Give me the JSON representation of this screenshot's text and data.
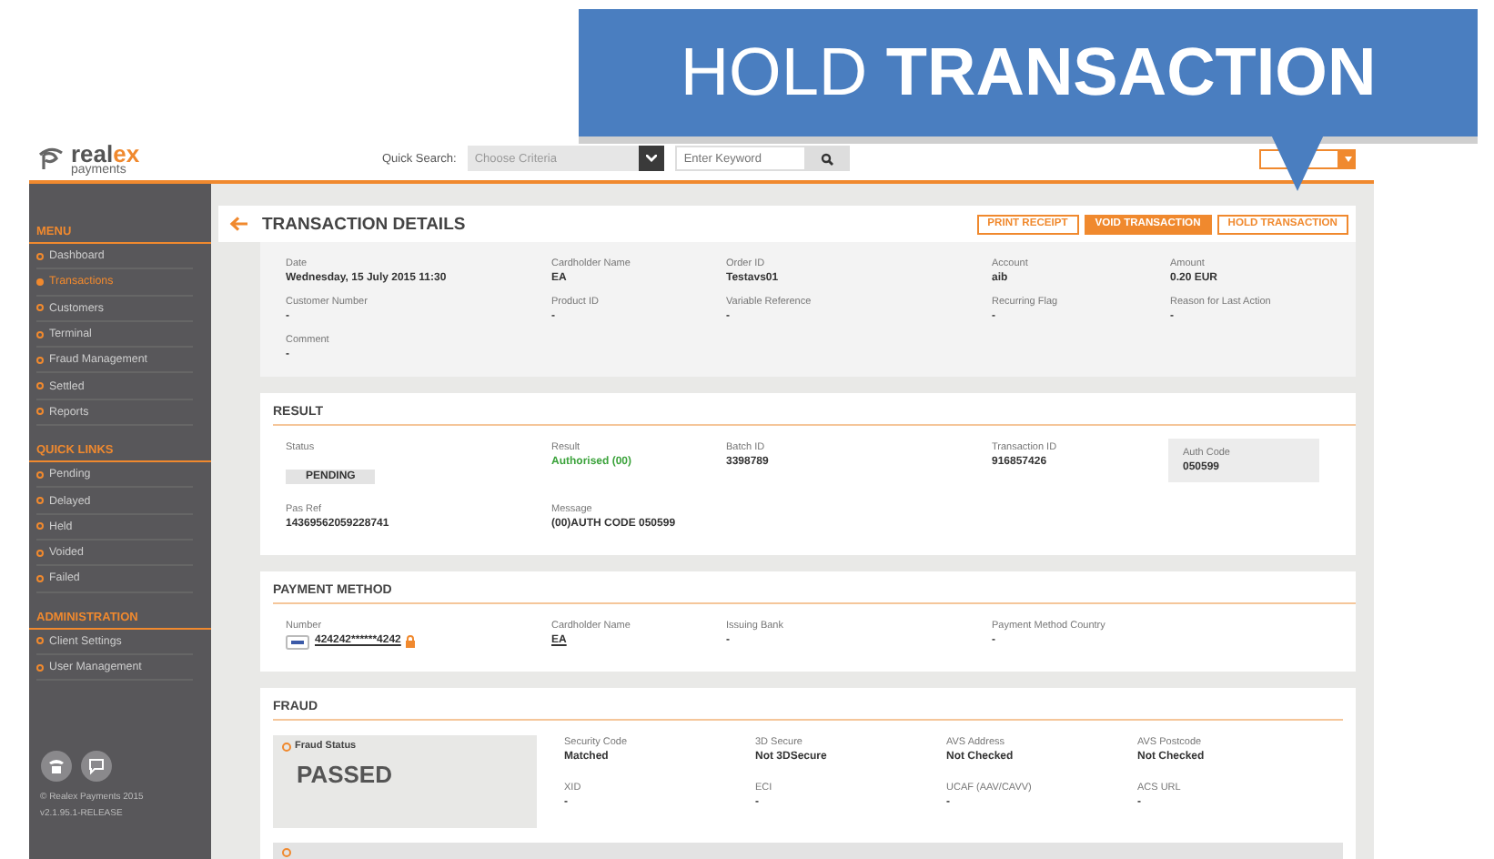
{
  "callout": {
    "text": "HOLD **TRANSACTION**"
  },
  "header": {
    "logo": {
      "main": "real",
      "accent": "ex",
      "sub": "payments"
    },
    "search_label": "Quick Search:",
    "criteria": "Choose Criteria",
    "keyword_placeholder": "Enter Keyword"
  },
  "sidebar": {
    "sections": [
      {
        "title": "MENU",
        "items": [
          {
            "label": "Dashboard",
            "selected": false
          },
          {
            "label": "Transactions",
            "selected": true
          },
          {
            "label": "Customers",
            "selected": false
          },
          {
            "label": "Terminal",
            "selected": false
          },
          {
            "label": "Fraud Management",
            "selected": false
          },
          {
            "label": "Settled",
            "selected": false
          },
          {
            "label": "Reports",
            "selected": false
          }
        ]
      },
      {
        "title": "QUICK LINKS",
        "items": [
          {
            "label": "Pending",
            "selected": false
          },
          {
            "label": "Delayed",
            "selected": false
          },
          {
            "label": "Held",
            "selected": false
          },
          {
            "label": "Voided",
            "selected": false
          },
          {
            "label": "Failed",
            "selected": false
          }
        ]
      },
      {
        "title": "ADMINISTRATION",
        "items": [
          {
            "label": "Client Settings",
            "selected": false
          },
          {
            "label": "User Management",
            "selected": false
          }
        ]
      }
    ],
    "copyright": "© Realex Payments 2015",
    "version": "v2.1.95.1-RELEASE"
  },
  "page": {
    "title": "TRANSACTION DETAILS",
    "actions": [
      {
        "label": "PRINT RECEIPT",
        "primary": false
      },
      {
        "label": "VOID TRANSACTION",
        "primary": true
      },
      {
        "label": "HOLD TRANSACTION",
        "primary": false
      }
    ],
    "details": [
      [
        {
          "label": "Date",
          "value": "Wednesday, 15 July 2015 11:30",
          "kind": "text"
        },
        {
          "label": "Cardholder Name",
          "value": "EA",
          "kind": "text"
        },
        {
          "label": "Order ID",
          "value": "Testavs01",
          "kind": "text"
        },
        {
          "label": "Account",
          "value": "aib",
          "kind": "text"
        },
        {
          "label": "Amount",
          "value": "0.20 EUR",
          "kind": "text"
        }
      ],
      [
        {
          "label": "Customer Number",
          "value": "-",
          "kind": "text"
        },
        {
          "label": "Product ID",
          "value": "-",
          "kind": "text"
        },
        {
          "label": "Variable Reference",
          "value": "-",
          "kind": "text"
        },
        {
          "label": "Recurring Flag",
          "value": "-",
          "kind": "text"
        },
        {
          "label": "Reason for Last Action",
          "value": "-",
          "kind": "text"
        }
      ],
      [
        {
          "label": "Comment",
          "value": "-",
          "kind": "text"
        }
      ]
    ],
    "result": {
      "title": "RESULT",
      "rows": [
        [
          {
            "label": "Status",
            "value": "PENDING",
            "kind": "badge"
          },
          {
            "label": "Result",
            "value": "Authorised (00)",
            "kind": "success"
          },
          {
            "label": "Batch ID",
            "value": "3398789",
            "kind": "text"
          },
          {
            "label": "Transaction ID",
            "value": "916857426",
            "kind": "text"
          }
        ],
        [
          {
            "label": "Pas Ref",
            "value": "14369562059228741",
            "kind": "text"
          },
          {
            "label": "Message",
            "value": "(00)AUTH CODE 050599",
            "kind": "text"
          }
        ]
      ],
      "aside": {
        "label": "Auth Code",
        "value": "050599"
      }
    },
    "payment": {
      "title": "PAYMENT METHOD",
      "rows": [
        [
          {
            "label": "Number",
            "value": "424242******4242",
            "kind": "card"
          },
          {
            "label": "Cardholder Name",
            "value": "EA",
            "kind": "link"
          },
          {
            "label": "Issuing Bank",
            "value": "-",
            "kind": "text"
          },
          {
            "label": "Payment Method Country",
            "value": "-",
            "kind": "text"
          }
        ]
      ]
    },
    "fraud": {
      "title": "FRAUD",
      "status_label": "Fraud Status",
      "status": "PASSED",
      "rows": [
        [
          {
            "label": "Security Code",
            "value": "Matched",
            "kind": "text"
          },
          {
            "label": "3D Secure",
            "value": "Not 3DSecure",
            "kind": "text"
          },
          {
            "label": "AVS Address",
            "value": "Not Checked",
            "kind": "text"
          },
          {
            "label": "AVS Postcode",
            "value": "Not Checked",
            "kind": "text"
          }
        ],
        [
          {
            "label": "XID",
            "value": "-",
            "kind": "text"
          },
          {
            "label": "ECI",
            "value": "-",
            "kind": "text"
          },
          {
            "label": "UCAF (AAV/CAVV)",
            "value": "-",
            "kind": "text"
          },
          {
            "label": "ACS URL",
            "value": "-",
            "kind": "text"
          }
        ]
      ]
    }
  }
}
